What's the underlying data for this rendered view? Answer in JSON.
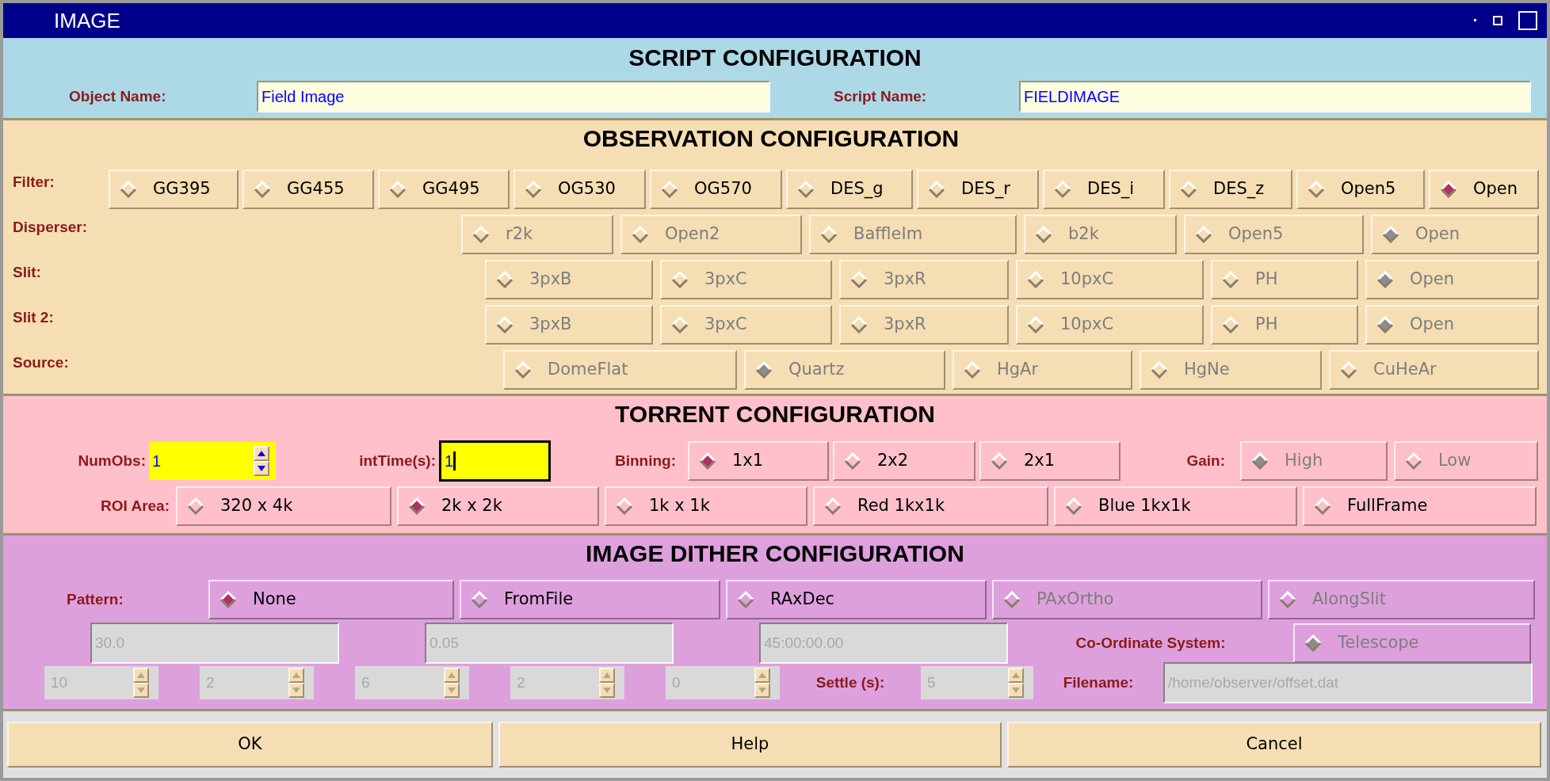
{
  "window": {
    "title": "IMAGE"
  },
  "script_configuration": {
    "title": "SCRIPT CONFIGURATION",
    "fields": [
      {
        "label": "Object Name:",
        "value": "Field Image"
      },
      {
        "label": "Script Name:",
        "value": "FIELDIMAGE"
      }
    ]
  },
  "observation_configuration": {
    "title": "OBSERVATION CONFIGURATION",
    "rows": [
      {
        "label": "Filter:",
        "disabled": false,
        "options": [
          {
            "label": "GG395",
            "selected": false
          },
          {
            "label": "GG455",
            "selected": false
          },
          {
            "label": "GG495",
            "selected": false
          },
          {
            "label": "OG530",
            "selected": false
          },
          {
            "label": "OG570",
            "selected": false
          },
          {
            "label": "DES_g",
            "selected": false
          },
          {
            "label": "DES_r",
            "selected": false
          },
          {
            "label": "DES_i",
            "selected": false
          },
          {
            "label": "DES_z",
            "selected": false
          },
          {
            "label": "Open5",
            "selected": false
          },
          {
            "label": "Open",
            "selected": true
          }
        ]
      },
      {
        "label": "Disperser:",
        "disabled": true,
        "options": [
          {
            "label": "r2k",
            "selected": false
          },
          {
            "label": "Open2",
            "selected": false
          },
          {
            "label": "BaffleIm",
            "selected": false
          },
          {
            "label": "b2k",
            "selected": false
          },
          {
            "label": "Open5",
            "selected": false
          },
          {
            "label": "Open",
            "selected": true
          }
        ]
      },
      {
        "label": "Slit:",
        "disabled": true,
        "options": [
          {
            "label": "3pxB",
            "selected": false
          },
          {
            "label": "3pxC",
            "selected": false
          },
          {
            "label": "3pxR",
            "selected": false
          },
          {
            "label": "10pxC",
            "selected": false
          },
          {
            "label": "PH",
            "selected": false
          },
          {
            "label": "Open",
            "selected": true
          }
        ]
      },
      {
        "label": "Slit 2:",
        "disabled": true,
        "options": [
          {
            "label": "3pxB",
            "selected": false
          },
          {
            "label": "3pxC",
            "selected": false
          },
          {
            "label": "3pxR",
            "selected": false
          },
          {
            "label": "10pxC",
            "selected": false
          },
          {
            "label": "PH",
            "selected": false
          },
          {
            "label": "Open",
            "selected": true
          }
        ]
      },
      {
        "label": "Source:",
        "disabled": true,
        "options": [
          {
            "label": "DomeFlat",
            "selected": false
          },
          {
            "label": "Quartz",
            "selected": true
          },
          {
            "label": "HgAr",
            "selected": false
          },
          {
            "label": "HgNe",
            "selected": false
          },
          {
            "label": "CuHeAr",
            "selected": false
          }
        ]
      }
    ]
  },
  "torrent_configuration": {
    "title": "TORRENT CONFIGURATION",
    "num_obs": {
      "label": "NumObs:",
      "value": "1"
    },
    "int_time": {
      "label": "intTime(s):",
      "value": "1",
      "focused": true
    },
    "binning": {
      "label": "Binning:",
      "disabled": false,
      "options": [
        {
          "label": "1x1",
          "selected": true
        },
        {
          "label": "2x2",
          "selected": false
        },
        {
          "label": "2x1",
          "selected": false
        }
      ]
    },
    "gain": {
      "label": "Gain:",
      "disabled": true,
      "options": [
        {
          "label": "High",
          "selected": true
        },
        {
          "label": "Low",
          "selected": false
        }
      ]
    },
    "roi_area": {
      "label": "ROI Area:",
      "disabled": false,
      "options": [
        {
          "label": "320 x 4k",
          "selected": false
        },
        {
          "label": "2k x 2k",
          "selected": true
        },
        {
          "label": "1k x 1k",
          "selected": false
        },
        {
          "label": "Red 1kx1k",
          "selected": false
        },
        {
          "label": "Blue 1kx1k",
          "selected": false
        },
        {
          "label": "FullFrame",
          "selected": false
        }
      ]
    }
  },
  "image_dither_configuration": {
    "title": "IMAGE DITHER CONFIGURATION",
    "pattern": {
      "label": "Pattern:",
      "options": [
        {
          "label": "None",
          "selected": true,
          "disabled": false
        },
        {
          "label": "FromFile",
          "selected": false,
          "disabled": false
        },
        {
          "label": "RAxDec",
          "selected": false,
          "disabled": false
        },
        {
          "label": "PAxOrtho",
          "selected": false,
          "disabled": true
        },
        {
          "label": "AlongSlit",
          "selected": false,
          "disabled": true
        }
      ]
    },
    "fields": [
      {
        "value": "30.0",
        "disabled": true
      },
      {
        "value": "0.05",
        "disabled": true
      },
      {
        "value": "45:00:00.00",
        "disabled": true
      }
    ],
    "coordinate_system": {
      "label": "Co-Ordinate System:",
      "options": [
        {
          "label": "Telescope",
          "selected": true,
          "disabled": true
        }
      ]
    },
    "spinners": [
      {
        "value": "10",
        "disabled": true
      },
      {
        "value": "2",
        "disabled": true
      },
      {
        "value": "6",
        "disabled": true
      },
      {
        "value": "2",
        "disabled": true
      },
      {
        "value": "0",
        "disabled": true
      }
    ],
    "settle": {
      "label": "Settle (s):",
      "value": "5",
      "disabled": true
    },
    "filename": {
      "label": "Filename:",
      "value": "/home/observer/offset.dat",
      "disabled": true
    }
  },
  "buttons": [
    {
      "label": "OK"
    },
    {
      "label": "Help"
    },
    {
      "label": "Cancel"
    }
  ]
}
